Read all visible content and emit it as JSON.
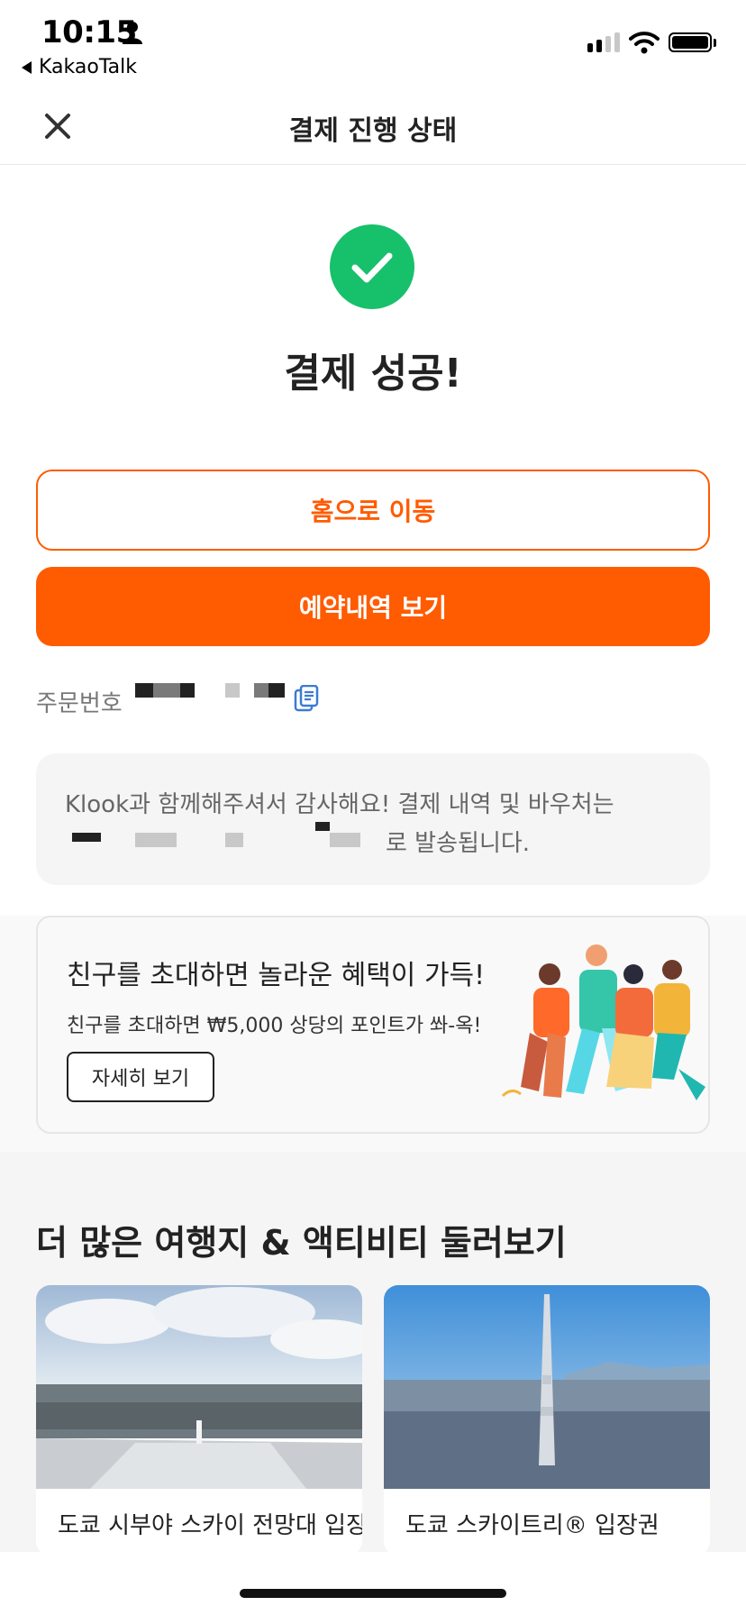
{
  "status_bar": {
    "time": "10:15",
    "back_app": "KakaoTalk"
  },
  "nav": {
    "title": "결제 진행 상태",
    "close_icon": "close-icon"
  },
  "success": {
    "title": "결제 성공!",
    "icon": "check-circle-icon",
    "color": "#17c06a"
  },
  "buttons": {
    "home": "홈으로 이동",
    "booking": "예약내역 보기",
    "accent": "#ff5b00"
  },
  "order": {
    "label": "주문번호",
    "copy_icon": "copy-icon"
  },
  "notice": {
    "line1": "Klook과 함께해주셔서 감사해요! 결제 내역 및 바우처는",
    "line2": "로 발송됩니다."
  },
  "invite": {
    "title": "친구를 초대하면 놀라운 혜택이 가득!",
    "subtitle": "친구를 초대하면 ₩5,000 상당의 포인트가 쏴-옥!",
    "button": "자세히 보기"
  },
  "more": {
    "title": "더 많은 여행지 & 액티비티 둘러보기",
    "cards": [
      {
        "title": "도쿄 시부야 스카이 전망대 입장권"
      },
      {
        "title": "도쿄 스카이트리® 입장권"
      }
    ]
  }
}
